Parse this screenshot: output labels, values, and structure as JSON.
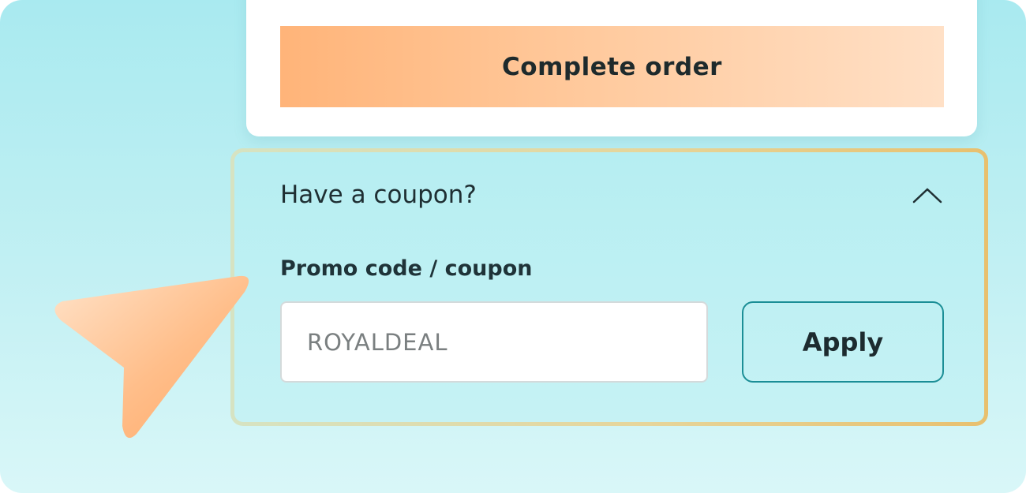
{
  "checkout": {
    "complete_order_label": "Complete order"
  },
  "coupon": {
    "title": "Have a coupon?",
    "expanded": true,
    "toggle_icon": "chevron-up-icon",
    "promo_label": "Promo code / coupon",
    "promo_placeholder": "ROYALDEAL",
    "promo_value": "",
    "apply_label": "Apply"
  },
  "pointer": {
    "icon": "cursor-arrow-icon"
  },
  "colors": {
    "background_top": "#a9eaf0",
    "background_bottom": "#d9f7f8",
    "order_button_start": "#ffb479",
    "order_button_end": "#ffe0c6",
    "apply_border": "#1b8e96",
    "panel_border_gold": "#e8c06e",
    "pointer_orange": "#ffac6a"
  }
}
